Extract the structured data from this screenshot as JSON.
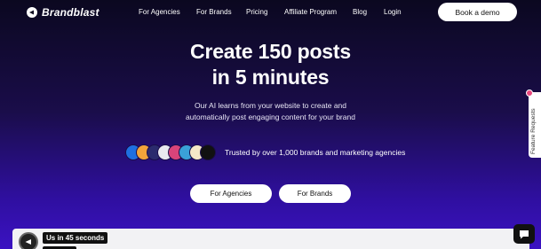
{
  "brand": {
    "name": "Brandblast",
    "icon": "brandblast-logo-icon"
  },
  "nav": {
    "links": [
      "For Agencies",
      "For Brands",
      "Pricing",
      "Affiliate Program",
      "Blog",
      "Login"
    ],
    "cta_label": "Book a demo"
  },
  "hero": {
    "headline_line1": "Create 150 posts",
    "headline_line2": "in 5 minutes",
    "sub_line1": "Our AI learns from your website to create and",
    "sub_line2": "automatically post engaging content for your brand",
    "trust_text": "Trusted by over 1,000 brands and marketing agencies",
    "primary_cta": "For Agencies",
    "secondary_cta": "For Brands"
  },
  "video": {
    "label": "Us in 45 seconds"
  },
  "feature_tab": {
    "label": "Feature Requests"
  },
  "colors": {
    "background_top": "#0b0820",
    "background_bottom": "#3b12c2",
    "button_bg": "#ffffff",
    "badge": "#e8467c"
  }
}
